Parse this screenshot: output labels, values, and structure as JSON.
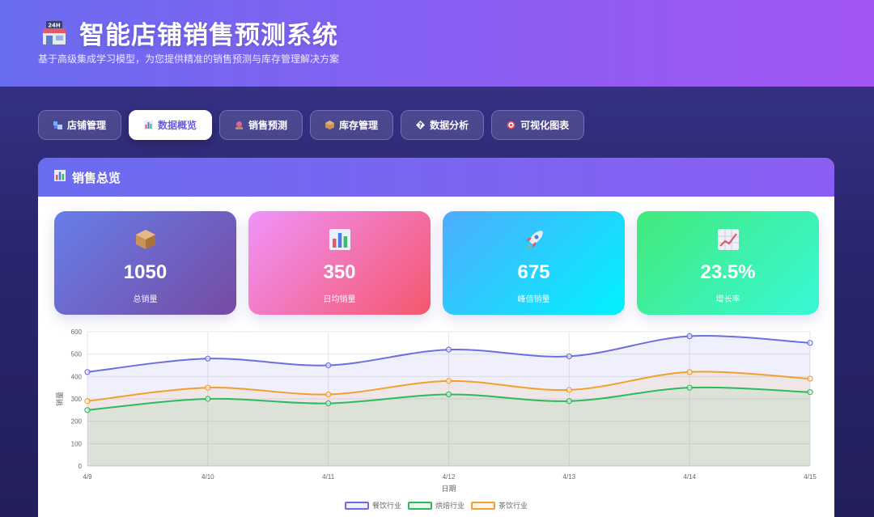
{
  "header": {
    "title": "智能店铺销售预测系统",
    "subtitle": "基于高级集成学习模型，为您提供精准的销售预测与库存管理解决方案",
    "icon": "store-24h-icon"
  },
  "nav": [
    {
      "label": "店铺管理",
      "icon": "store-blocks-icon",
      "active": false
    },
    {
      "label": "数据概览",
      "icon": "bar-chart-icon",
      "active": true
    },
    {
      "label": "销售预测",
      "icon": "crystal-ball-icon",
      "active": false
    },
    {
      "label": "库存管理",
      "icon": "package-icon",
      "active": false
    },
    {
      "label": "数据分析",
      "icon": "unknown-glyph-icon",
      "active": false
    },
    {
      "label": "可视化图表",
      "icon": "target-icon",
      "active": false
    }
  ],
  "panel": {
    "title": "销售总览",
    "icon": "bar-chart-icon"
  },
  "stats": [
    {
      "value": "1050",
      "label": "总销量",
      "icon": "package-icon"
    },
    {
      "value": "350",
      "label": "日均销量",
      "icon": "bar-chart-icon"
    },
    {
      "value": "675",
      "label": "峰值销量",
      "icon": "rocket-icon"
    },
    {
      "value": "23.5%",
      "label": "增长率",
      "icon": "trend-up-icon"
    }
  ],
  "colors": {
    "accent": "#6a6cf0",
    "series_1": "#6c6ee0",
    "series_2": "#2dba5f",
    "series_3": "#f0a030"
  },
  "chart_data": {
    "type": "area",
    "x": [
      "4/9",
      "4/10",
      "4/11",
      "4/12",
      "4/13",
      "4/14",
      "4/15"
    ],
    "series": [
      {
        "name": "餐饮行业",
        "values": [
          420,
          480,
          450,
          520,
          490,
          580,
          550
        ]
      },
      {
        "name": "烘焙行业",
        "values": [
          250,
          300,
          280,
          320,
          290,
          350,
          330
        ]
      },
      {
        "name": "茶饮行业",
        "values": [
          290,
          350,
          320,
          380,
          340,
          420,
          390
        ]
      }
    ],
    "xlabel": "日期",
    "ylabel": "销量",
    "ylim": [
      0,
      600
    ],
    "yticks": [
      "0",
      "100",
      "200",
      "300",
      "400",
      "500",
      "600"
    ],
    "grid": true,
    "legend": "bottom-center"
  }
}
